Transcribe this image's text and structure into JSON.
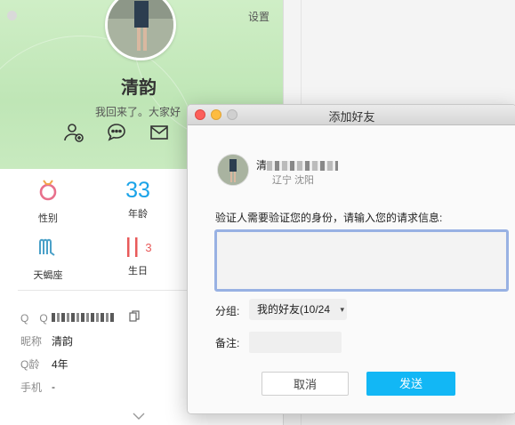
{
  "profile": {
    "settings_label": "设置",
    "nickname": "清韵",
    "signature": "我回来了。大家好",
    "actions": [
      {
        "icon": "add-friend-icon"
      },
      {
        "icon": "chat-bubble-icon"
      },
      {
        "icon": "mail-icon"
      }
    ],
    "tiles": [
      {
        "icon": "gender-female-icon",
        "label": "性别"
      },
      {
        "icon": "age-number",
        "value": "33",
        "label": "年龄"
      },
      {
        "icon": "scorpio-icon",
        "label": "天蝎座"
      },
      {
        "icon": "birthday-icon",
        "value": "3",
        "label": "生日"
      }
    ],
    "info": {
      "qq_key": "Q　Q",
      "nickname_key": "昵称",
      "nickname_val": "清韵",
      "qage_key": "Q龄",
      "qage_val": "4年",
      "phone_key": "手机",
      "phone_val": "-"
    }
  },
  "dialog": {
    "title": "添加好友",
    "user_name_prefix": "清",
    "user_location": "辽宁 沈阳",
    "prompt": "验证人需要验证您的身份，请输入您的请求信息:",
    "group_label": "分组:",
    "group_value": "我的好友(10/24",
    "remark_label": "备注:",
    "cancel_label": "取消",
    "send_label": "发送"
  },
  "colors": {
    "banner_green": "#c8eabf",
    "send_blue": "#12b7f5",
    "focus_border": "#98b1e3",
    "age_blue": "#1aa3e8",
    "birthday_red": "#e85a5a"
  }
}
